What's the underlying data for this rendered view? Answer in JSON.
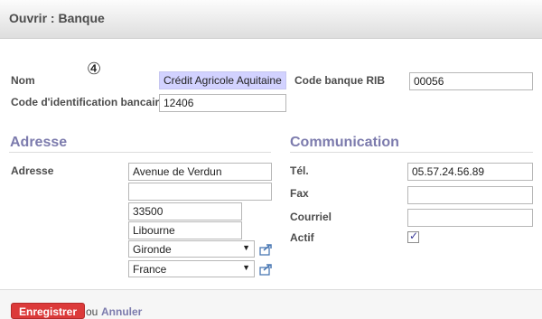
{
  "header": {
    "title": "Ouvrir : Banque"
  },
  "annotation": "④",
  "fields": {
    "nom": {
      "label": "Nom",
      "value": "Crédit Agricole Aquitaine"
    },
    "code_rib": {
      "label": "Code banque RIB",
      "value": "00056"
    },
    "code_id": {
      "label": "Code d'identification bancaire",
      "value": "12406"
    }
  },
  "adresse_section": {
    "title": "Adresse",
    "label": "Adresse",
    "line1": "Avenue de Verdun",
    "line2": "",
    "zip": "33500",
    "city": "Libourne",
    "state": "Gironde",
    "country": "France"
  },
  "communication_section": {
    "title": "Communication",
    "tel_label": "Tél.",
    "tel_value": "05.57.24.56.89",
    "fax_label": "Fax",
    "fax_value": "",
    "email_label": "Courriel",
    "email_value": "",
    "actif_label": "Actif",
    "actif_checked": true
  },
  "footer": {
    "save_label": "Enregistrer",
    "or_label": "ou",
    "cancel_label": "Annuler"
  },
  "colors": {
    "accent": "#7c7bad",
    "save": "#dc3a3a",
    "highlight": "#d2d2ff"
  }
}
